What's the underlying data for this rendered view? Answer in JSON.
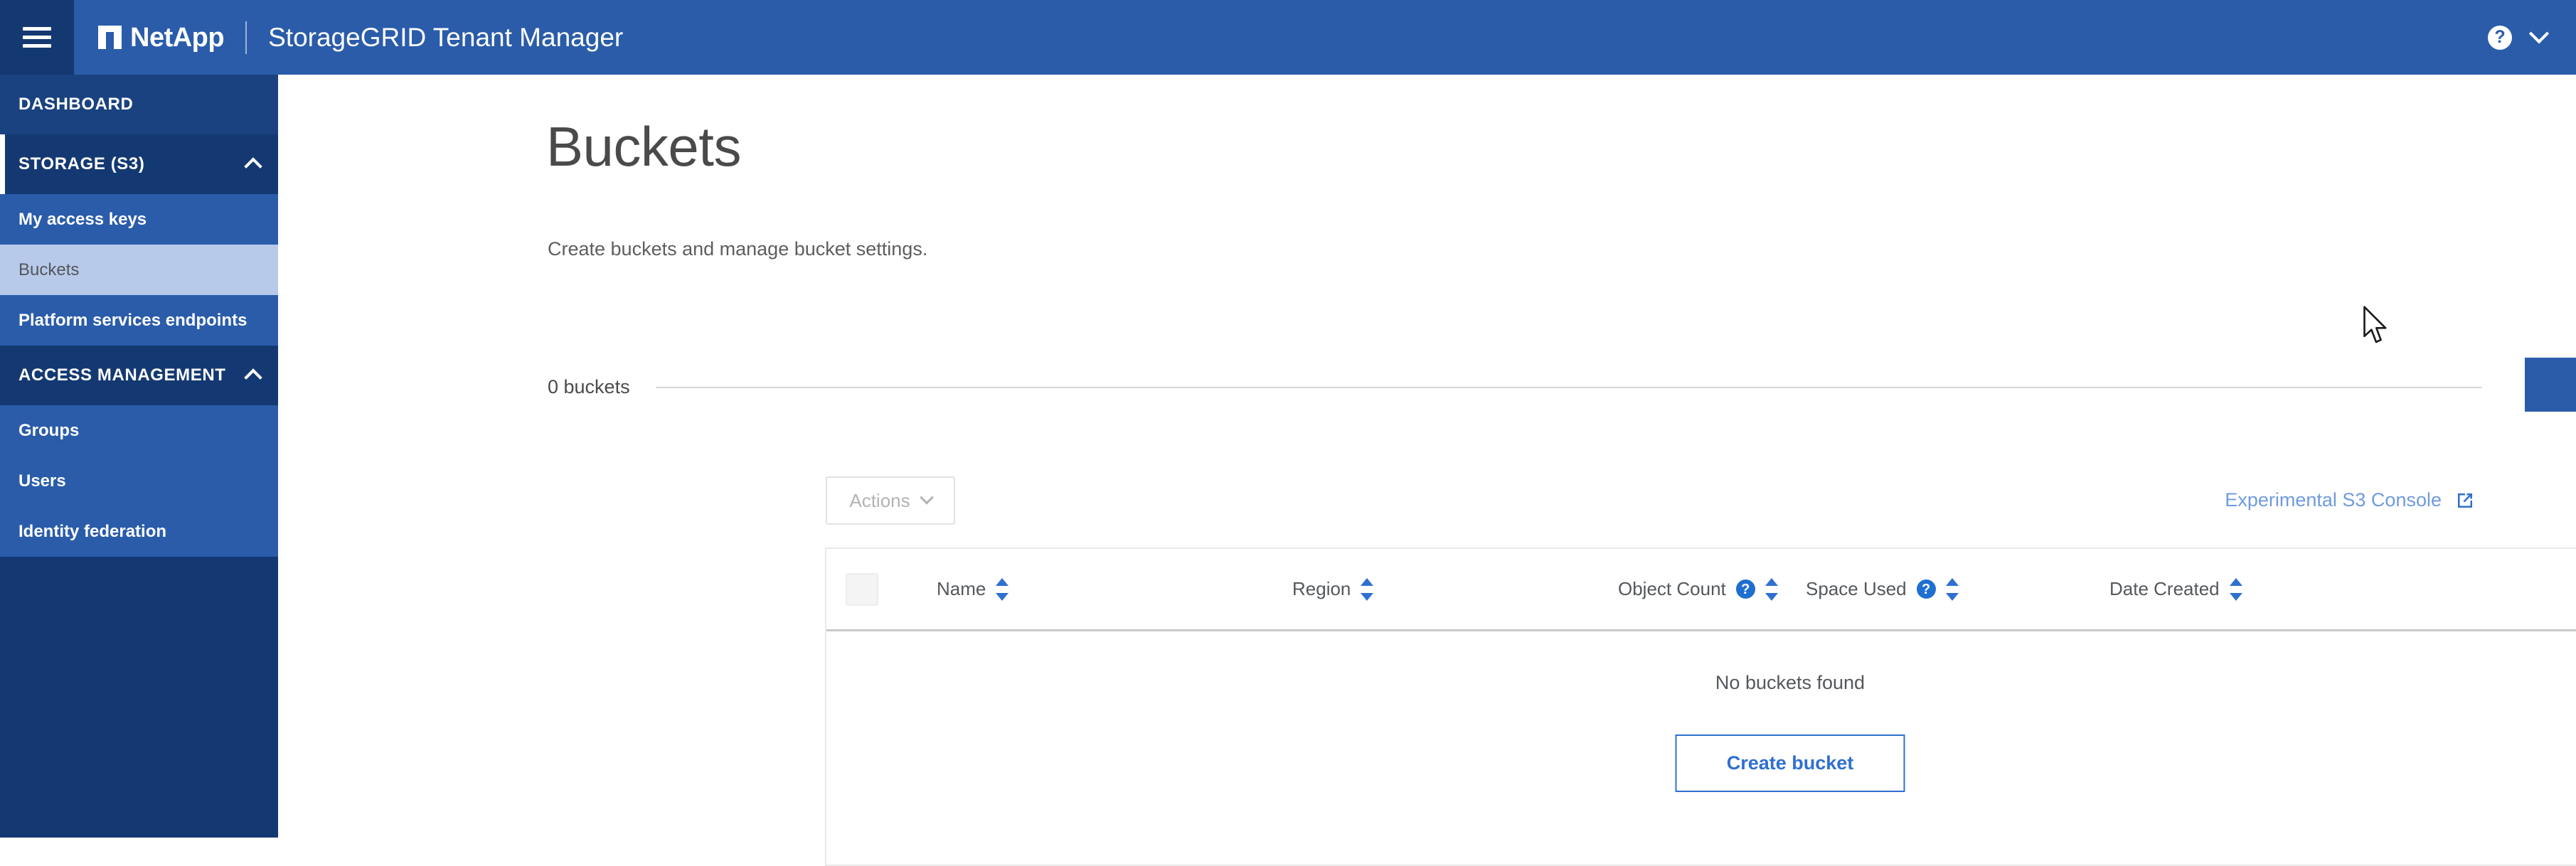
{
  "topbar": {
    "menu_icon": "hamburger-icon",
    "brand": "NetApp",
    "app_title": "StorageGRID Tenant Manager",
    "help_icon": "question-mark-icon",
    "account_chevron_icon": "chevron-down-icon"
  },
  "sidebar": {
    "items": [
      {
        "label": "DASHBOARD",
        "type": "section"
      },
      {
        "label": "STORAGE (S3)",
        "type": "section-collapsible",
        "expanded": true,
        "active": true
      },
      {
        "label": "My access keys",
        "type": "sub"
      },
      {
        "label": "Buckets",
        "type": "sub",
        "selected": true
      },
      {
        "label": "Platform services endpoints",
        "type": "sub"
      },
      {
        "label": "ACCESS MANAGEMENT",
        "type": "section-collapsible",
        "expanded": true
      },
      {
        "label": "Groups",
        "type": "sub"
      },
      {
        "label": "Users",
        "type": "sub"
      },
      {
        "label": "Identity federation",
        "type": "sub"
      }
    ]
  },
  "main": {
    "title": "Buckets",
    "subtitle": "Create buckets and manage bucket settings.",
    "bucket_count_label": "0 buckets",
    "create_bucket_primary": "Create bucket",
    "actions_label": "Actions",
    "s3_console_link": "Experimental S3 Console",
    "external_link_icon": "external-link-icon"
  },
  "table": {
    "columns": [
      {
        "label": "Name",
        "sortable": true,
        "help": false
      },
      {
        "label": "Region",
        "sortable": true,
        "help": false
      },
      {
        "label": "Object Count",
        "sortable": true,
        "help": true
      },
      {
        "label": "Space Used",
        "sortable": true,
        "help": true
      },
      {
        "label": "Date Created",
        "sortable": true,
        "help": false
      }
    ],
    "help_glyph": "?",
    "empty_message": "No buckets found",
    "empty_action": "Create bucket",
    "rows": []
  },
  "colors": {
    "brand_blue": "#2a5caa",
    "dark_navy": "#143972",
    "selected_nav": "#b7caea",
    "link_blue": "#2f6fd0",
    "muted_link": "#6f9be0"
  }
}
